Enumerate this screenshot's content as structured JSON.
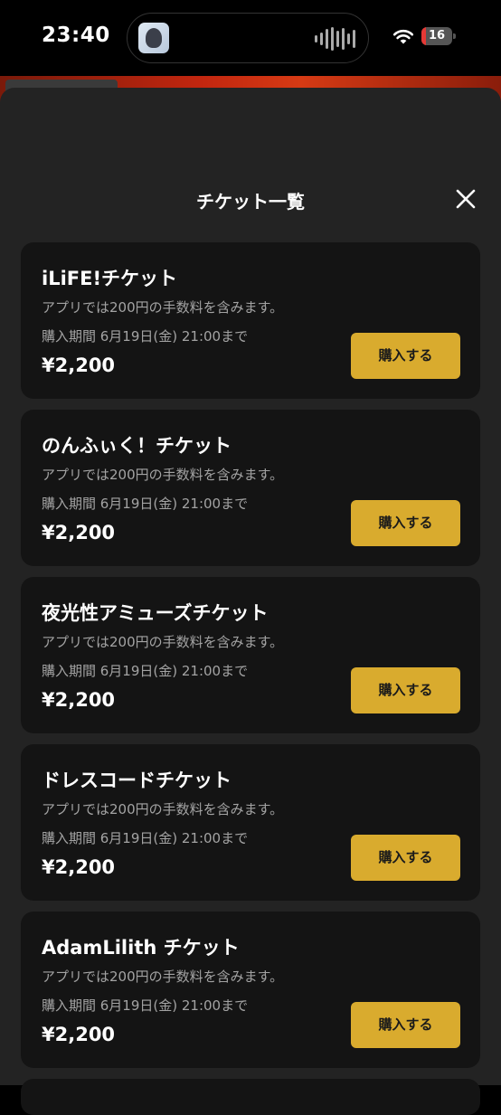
{
  "status": {
    "time": "23:40",
    "battery": "16",
    "battery_level": 0.16,
    "battery_color": "#e53935"
  },
  "sheet": {
    "title": "チケット一覧",
    "close_icon": "close-icon"
  },
  "tickets": [
    {
      "name": "iLiFE!チケット",
      "note": "アプリでは200円の手数料を含みます。",
      "period": "購入期間 6月19日(金) 21:00まで",
      "price": "¥2,200",
      "buy_label": "購入する"
    },
    {
      "name": "のんふぃく！チケット",
      "note": "アプリでは200円の手数料を含みます。",
      "period": "購入期間 6月19日(金) 21:00まで",
      "price": "¥2,200",
      "buy_label": "購入する"
    },
    {
      "name": "夜光性アミューズチケット",
      "note": "アプリでは200円の手数料を含みます。",
      "period": "購入期間 6月19日(金) 21:00まで",
      "price": "¥2,200",
      "buy_label": "購入する"
    },
    {
      "name": "ドレスコードチケット",
      "note": "アプリでは200円の手数料を含みます。",
      "period": "購入期間 6月19日(金) 21:00まで",
      "price": "¥2,200",
      "buy_label": "購入する"
    },
    {
      "name": "AdamLilith チケット",
      "note": "アプリでは200円の手数料を含みます。",
      "period": "購入期間 6月19日(金) 21:00まで",
      "price": "¥2,200",
      "buy_label": "購入する"
    }
  ],
  "colors": {
    "accent": "#d9ab2e",
    "sheet_bg": "#232323",
    "card_bg": "#141414"
  }
}
